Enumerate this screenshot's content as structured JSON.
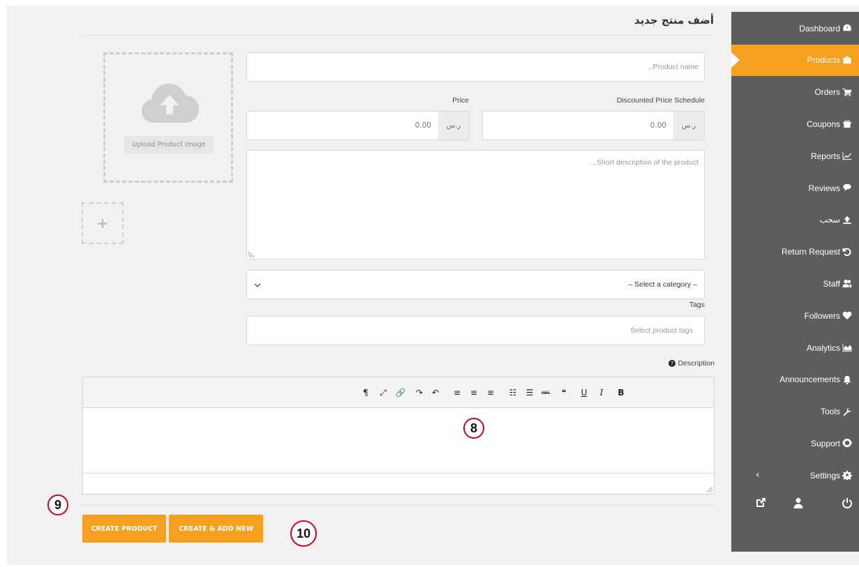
{
  "page": {
    "title": "أضف منتج جديد"
  },
  "sidebar": {
    "items": [
      {
        "label": "Dashboard",
        "icon": "dashboard-icon",
        "active": false
      },
      {
        "label": "Products",
        "icon": "briefcase-icon",
        "active": true
      },
      {
        "label": "Orders",
        "icon": "cart-icon",
        "active": false
      },
      {
        "label": "Coupons",
        "icon": "gift-icon",
        "active": false
      },
      {
        "label": "Reports",
        "icon": "line-chart-icon",
        "active": false
      },
      {
        "label": "Reviews",
        "icon": "comments-icon",
        "active": false
      },
      {
        "label": "سحب",
        "icon": "upload-icon",
        "active": false
      },
      {
        "label": "Return Request",
        "icon": "undo-icon",
        "active": false
      },
      {
        "label": "Staff",
        "icon": "users-icon",
        "active": false
      },
      {
        "label": "Followers",
        "icon": "heart-icon",
        "active": false
      },
      {
        "label": "Analytics",
        "icon": "area-chart-icon",
        "active": false
      },
      {
        "label": "Announcements",
        "icon": "bell-icon",
        "active": false
      },
      {
        "label": "Tools",
        "icon": "wrench-icon",
        "active": false
      },
      {
        "label": "Support",
        "icon": "life-ring-icon",
        "active": false
      },
      {
        "label": "Settings",
        "icon": "gear-icon",
        "active": false
      }
    ],
    "collapse_glyph": "‹",
    "bottom_icons": [
      "external-link-icon",
      "user-icon",
      "power-icon"
    ]
  },
  "form": {
    "product_name_placeholder": "..Product name",
    "price_label": "Price",
    "discounted_label": "Discounted Price Schedule",
    "currency": "ر.س",
    "price_value": "0.00",
    "discounted_value": "0.00",
    "short_desc_placeholder": "...Short description of the product",
    "category_placeholder": "– Select a category –",
    "tags_label": "Tags",
    "tags_placeholder": "Select product tags",
    "description_label": "Description",
    "upload_image_label": "Upload Product Image",
    "add_gallery_glyph": "+"
  },
  "editor": {
    "toolbar": [
      {
        "name": "bold-icon",
        "glyph": "B"
      },
      {
        "name": "italic-icon",
        "glyph": "I"
      },
      {
        "name": "underline-icon",
        "glyph": "U"
      },
      {
        "name": "blockquote-icon",
        "glyph": "❝"
      },
      {
        "name": "strikethrough-icon",
        "glyph": "ABC"
      },
      {
        "name": "bullet-list-icon",
        "glyph": "☰"
      },
      {
        "name": "numbered-list-icon",
        "glyph": "☷"
      },
      {
        "name": "align-left-icon",
        "glyph": "≡"
      },
      {
        "name": "align-center-icon",
        "glyph": "≡"
      },
      {
        "name": "align-right-icon",
        "glyph": "≡"
      },
      {
        "name": "undo-icon",
        "glyph": "↶"
      },
      {
        "name": "redo-icon",
        "glyph": "↷"
      },
      {
        "name": "link-icon",
        "glyph": "🔗"
      },
      {
        "name": "fullscreen-icon",
        "glyph": "⤢"
      },
      {
        "name": "paragraph-direction-icon",
        "glyph": "¶"
      }
    ]
  },
  "annotations": {
    "step8": "8",
    "step9": "9",
    "step10": "10"
  },
  "buttons": {
    "create": "CREATE PRODUCT",
    "create_add": "CREATE & ADD NEW"
  },
  "colors": {
    "accent": "#f6a01f",
    "sidebar": "#5d5d5d",
    "annotation": "#d4001f"
  }
}
